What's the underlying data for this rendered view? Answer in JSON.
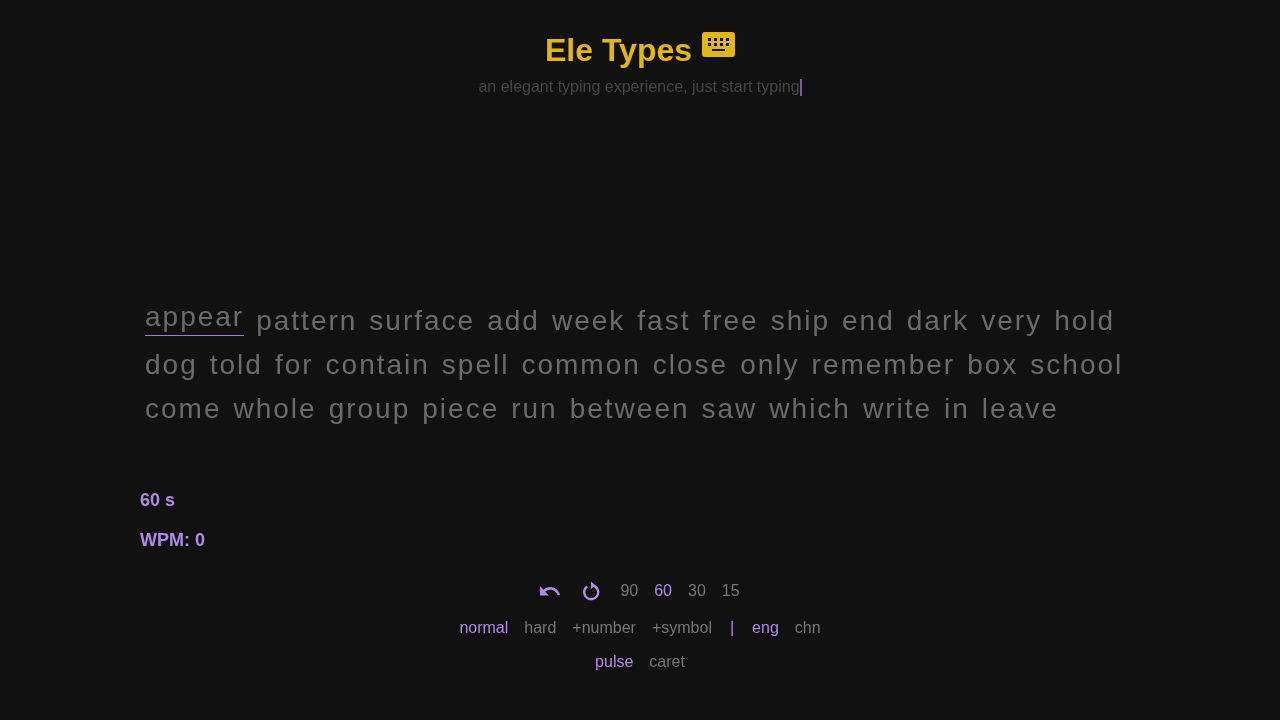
{
  "header": {
    "title": "Ele Types",
    "subtitle": "an elegant typing experience, just start typing"
  },
  "words": [
    {
      "text": "appear",
      "current": true
    },
    {
      "text": "pattern",
      "current": false
    },
    {
      "text": "surface",
      "current": false
    },
    {
      "text": "add",
      "current": false
    },
    {
      "text": "week",
      "current": false
    },
    {
      "text": "fast",
      "current": false
    },
    {
      "text": "free",
      "current": false
    },
    {
      "text": "ship",
      "current": false
    },
    {
      "text": "end",
      "current": false
    },
    {
      "text": "dark",
      "current": false
    },
    {
      "text": "very",
      "current": false
    },
    {
      "text": "hold",
      "current": false
    },
    {
      "text": "dog",
      "current": false
    },
    {
      "text": "told",
      "current": false
    },
    {
      "text": "for",
      "current": false
    },
    {
      "text": "contain",
      "current": false
    },
    {
      "text": "spell",
      "current": false
    },
    {
      "text": "common",
      "current": false
    },
    {
      "text": "close",
      "current": false
    },
    {
      "text": "only",
      "current": false
    },
    {
      "text": "remember",
      "current": false
    },
    {
      "text": "box",
      "current": false
    },
    {
      "text": "school",
      "current": false
    },
    {
      "text": "come",
      "current": false
    },
    {
      "text": "whole",
      "current": false
    },
    {
      "text": "group",
      "current": false
    },
    {
      "text": "piece",
      "current": false
    },
    {
      "text": "run",
      "current": false
    },
    {
      "text": "between",
      "current": false
    },
    {
      "text": "saw",
      "current": false
    },
    {
      "text": "which",
      "current": false
    },
    {
      "text": "write",
      "current": false
    },
    {
      "text": "in",
      "current": false
    },
    {
      "text": "leave",
      "current": false
    }
  ],
  "stats": {
    "timer": "60 s",
    "wpm": "WPM: 0"
  },
  "durations": [
    {
      "label": "90",
      "selected": false
    },
    {
      "label": "60",
      "selected": true
    },
    {
      "label": "30",
      "selected": false
    },
    {
      "label": "15",
      "selected": false
    }
  ],
  "modes": [
    {
      "label": "normal",
      "selected": true
    },
    {
      "label": "hard",
      "selected": false
    },
    {
      "label": "+number",
      "selected": false
    },
    {
      "label": "+symbol",
      "selected": false
    }
  ],
  "separator": "|",
  "languages": [
    {
      "label": "eng",
      "selected": true
    },
    {
      "label": "chn",
      "selected": false
    }
  ],
  "caret_styles": [
    {
      "label": "pulse",
      "selected": true
    },
    {
      "label": "caret",
      "selected": false
    }
  ]
}
